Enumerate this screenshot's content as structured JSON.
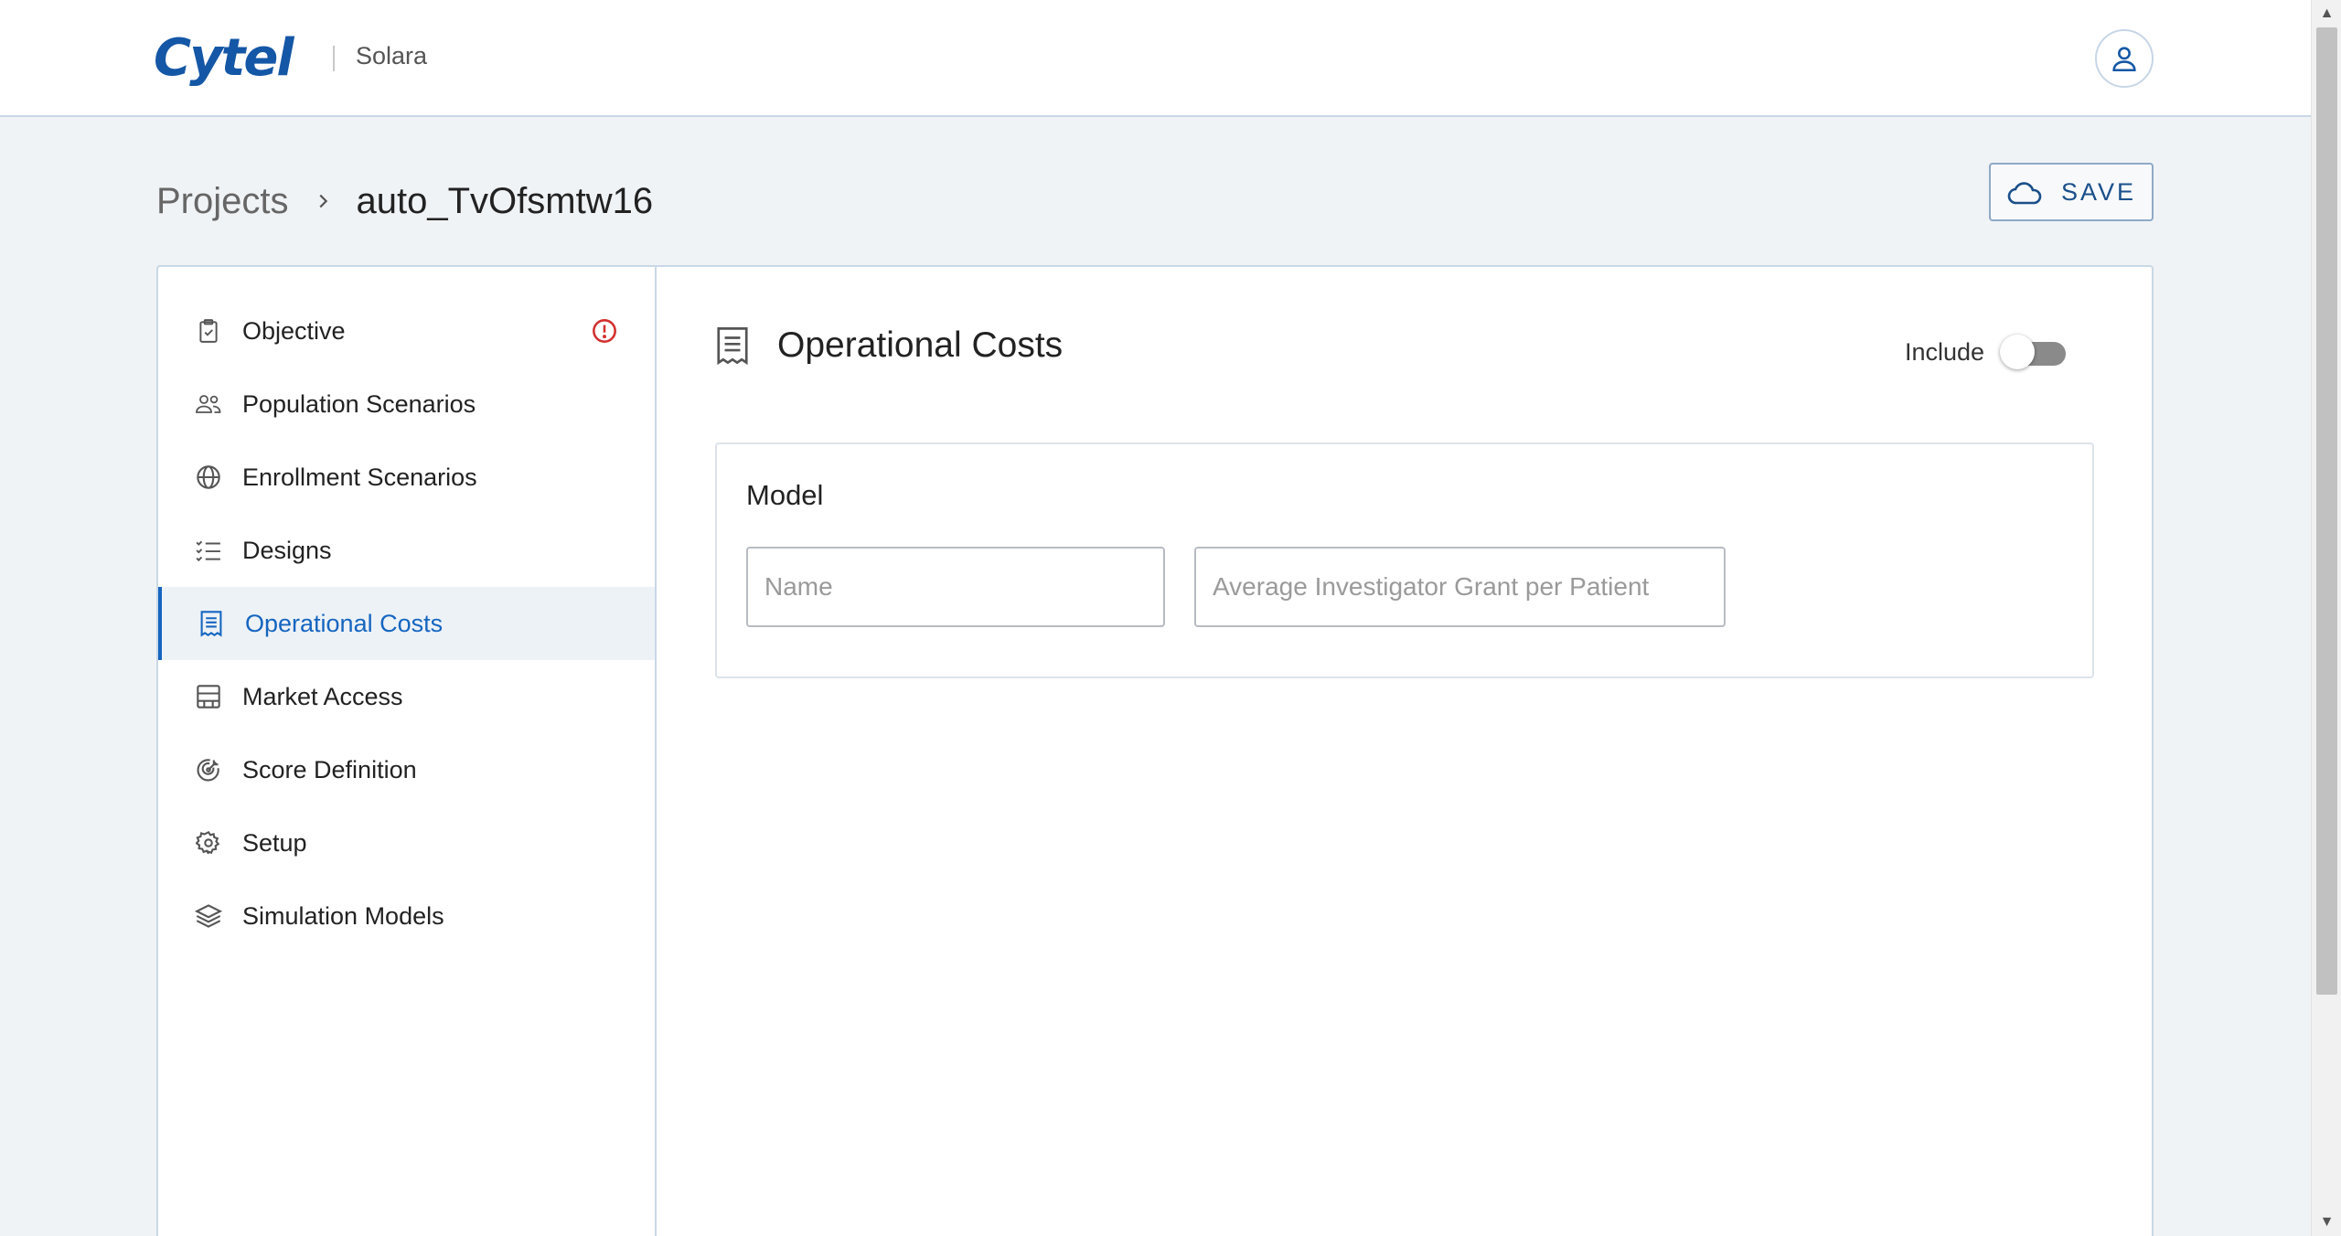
{
  "header": {
    "logo_text": "Cytel",
    "app_name": "Solara",
    "avatar_icon": "user-icon"
  },
  "breadcrumb": {
    "root": "Projects",
    "separator_icon": "chevron-right-icon",
    "current": "auto_TvOfsmtw16"
  },
  "toolbar": {
    "save_label": "SAVE",
    "save_icon": "cloud-icon"
  },
  "sidebar": {
    "active_index": 4,
    "items": [
      {
        "label": "Objective",
        "icon": "clipboard-check-icon",
        "warning": true
      },
      {
        "label": "Population Scenarios",
        "icon": "people-icon"
      },
      {
        "label": "Enrollment Scenarios",
        "icon": "globe-icon"
      },
      {
        "label": "Designs",
        "icon": "checklist-icon"
      },
      {
        "label": "Operational Costs",
        "icon": "receipt-icon"
      },
      {
        "label": "Market Access",
        "icon": "building-icon"
      },
      {
        "label": "Score Definition",
        "icon": "target-icon"
      },
      {
        "label": "Setup",
        "icon": "gear-icon"
      },
      {
        "label": "Simulation Models",
        "icon": "layers-icon"
      }
    ]
  },
  "main": {
    "section_title": "Operational Costs",
    "section_icon": "receipt-icon",
    "include_label": "Include",
    "include_on": false,
    "model": {
      "title": "Model",
      "name_placeholder": "Name",
      "name_value": "",
      "grant_placeholder": "Average Investigator Grant per Patient",
      "grant_value": ""
    }
  },
  "colors": {
    "brand": "#1457a6",
    "accent": "#1565c0",
    "warning": "#d32f2f",
    "page_bg": "#f0f3f6"
  }
}
